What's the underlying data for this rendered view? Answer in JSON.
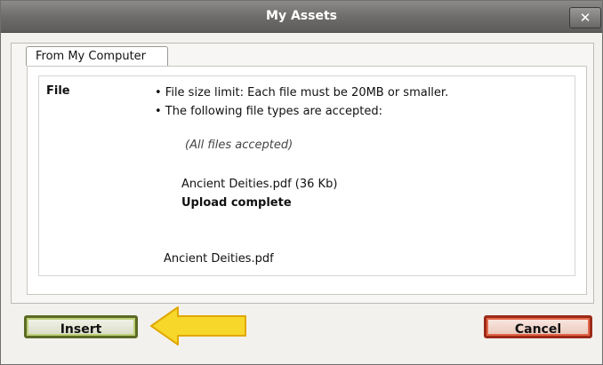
{
  "dialog": {
    "title": "My Assets",
    "close_label": "✕",
    "tab_label": "From My Computer"
  },
  "file_section": {
    "label": "File",
    "bullet_1": "• File size limit: Each file must be 20MB or smaller.",
    "bullet_2": "• The following file types are accepted:",
    "accepted_note": "(All files accepted)",
    "uploaded_file": "Ancient Deities.pdf (36 Kb)",
    "upload_status": "Upload complete",
    "selected_file": "Ancient Deities.pdf"
  },
  "buttons": {
    "insert_label": "Insert",
    "cancel_label": "Cancel"
  },
  "annotation": {
    "arrow_icon": "left-pointing-arrow-icon",
    "arrow_color": "#f7d72a"
  }
}
